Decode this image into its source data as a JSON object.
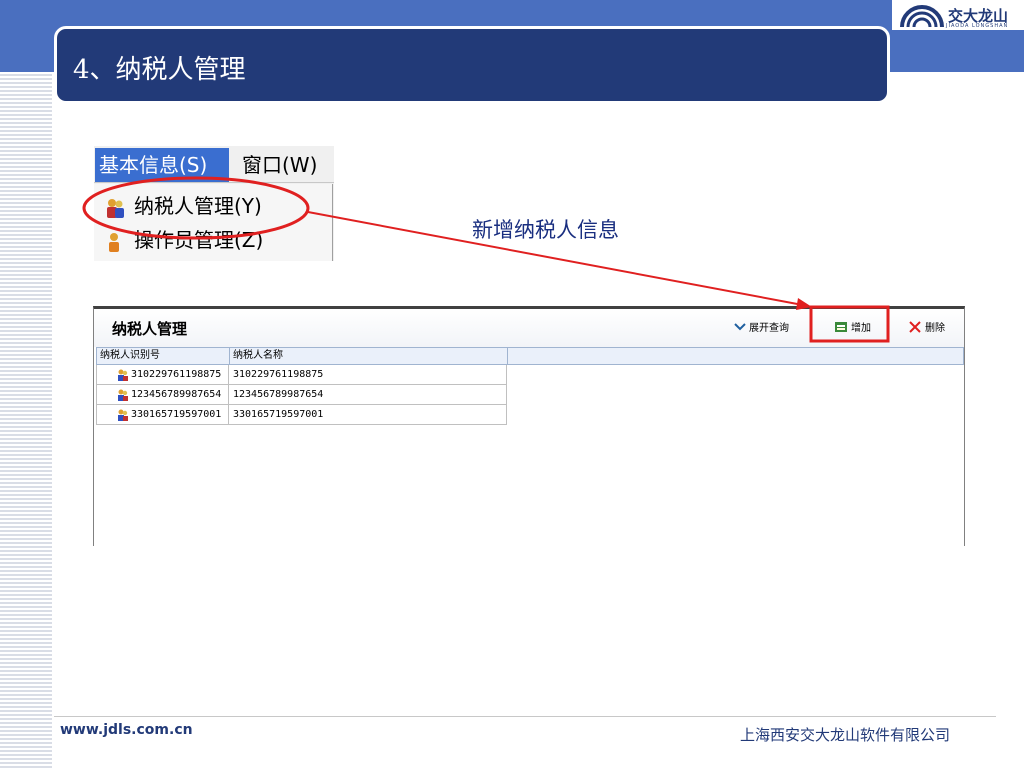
{
  "slide": {
    "title": "4、纳税人管理",
    "annotation": "新增纳税人信息"
  },
  "logo": {
    "name": "交大龙山",
    "sub": "JIAODA LONGSHAN"
  },
  "menu": {
    "active": "基本信息(S)",
    "window": "窗口(W)",
    "items": [
      "纳税人管理(Y)",
      "操作员管理(Z)"
    ]
  },
  "panel": {
    "title": "纳税人管理",
    "toolbar": {
      "expand": "展开查询",
      "add": "增加",
      "delete": "删除"
    },
    "columns": [
      "纳税人识别号",
      "纳税人名称"
    ],
    "rows": [
      {
        "id": "310229761198875",
        "name": "310229761198875"
      },
      {
        "id": "123456789987654",
        "name": "123456789987654"
      },
      {
        "id": "330165719597001",
        "name": "330165719597001"
      }
    ]
  },
  "footer": {
    "url": "www.jdls.com.cn",
    "company": "上海西安交大龙山软件有限公司"
  },
  "colors": {
    "brand_dark": "#223a78",
    "brand_band": "#4a6fbf",
    "highlight": "#e02020"
  }
}
